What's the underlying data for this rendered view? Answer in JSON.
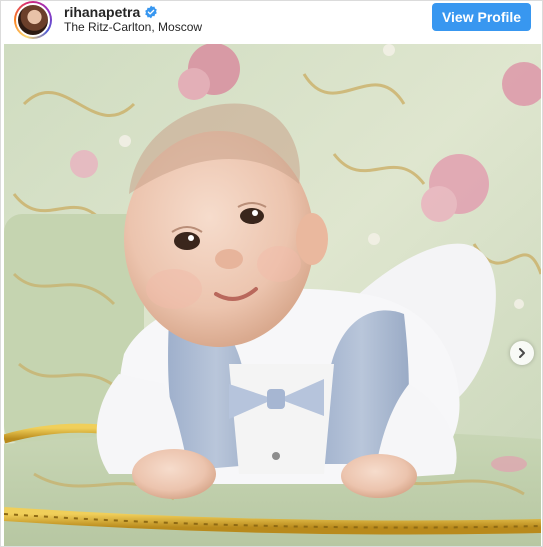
{
  "post": {
    "username": "rihanapetra",
    "location": "The Ritz-Carlton, Moscow",
    "view_profile_label": "View Profile"
  },
  "icons": {
    "verified": "verified-badge-icon",
    "next": "chevron-right-icon"
  },
  "colors": {
    "button": "#3897f0",
    "verified": "#3897f0"
  }
}
